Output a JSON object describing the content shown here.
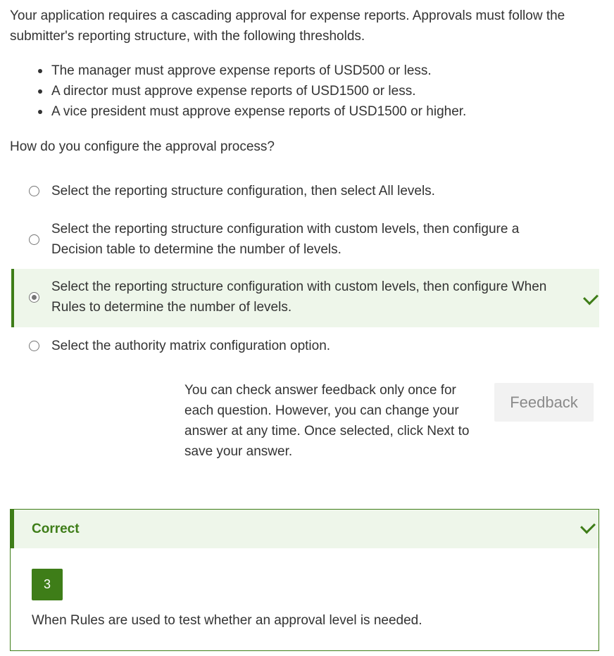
{
  "intro": "Your application requires a cascading approval for expense reports. Approvals must follow the submitter's reporting structure, with the following thresholds.",
  "bullets": [
    "The manager must approve expense reports of USD500 or less.",
    "A director must approve expense reports of USD1500 or less.",
    "A vice president must approve expense reports of USD1500 or higher."
  ],
  "question": "How do you configure the approval process?",
  "options": [
    {
      "label": "Select the reporting structure configuration, then select All levels.",
      "selected": false,
      "correct": false
    },
    {
      "label": "Select the reporting structure configuration with custom levels, then configure a Decision table to determine the number of levels.",
      "selected": false,
      "correct": false
    },
    {
      "label": "Select the reporting structure configuration with custom levels, then configure When Rules to determine the number of levels.",
      "selected": true,
      "correct": true
    },
    {
      "label": "Select the authority matrix configuration option.",
      "selected": false,
      "correct": false
    }
  ],
  "note": "You can check answer feedback only once for each question. However, you can change your answer at any time. Once selected, click Next to save your answer.",
  "feedback_button": "Feedback",
  "result": {
    "title": "Correct",
    "answer_number": "3",
    "explanation": "When Rules are used to test whether an approval level is needed."
  },
  "colors": {
    "accent_green": "#3e7d18",
    "correct_bg": "#eef6ea",
    "button_bg": "#f2f2f2"
  },
  "icons": {
    "check": "checkmark-icon",
    "radio": "radio-button",
    "bullet": "disc-bullet"
  }
}
